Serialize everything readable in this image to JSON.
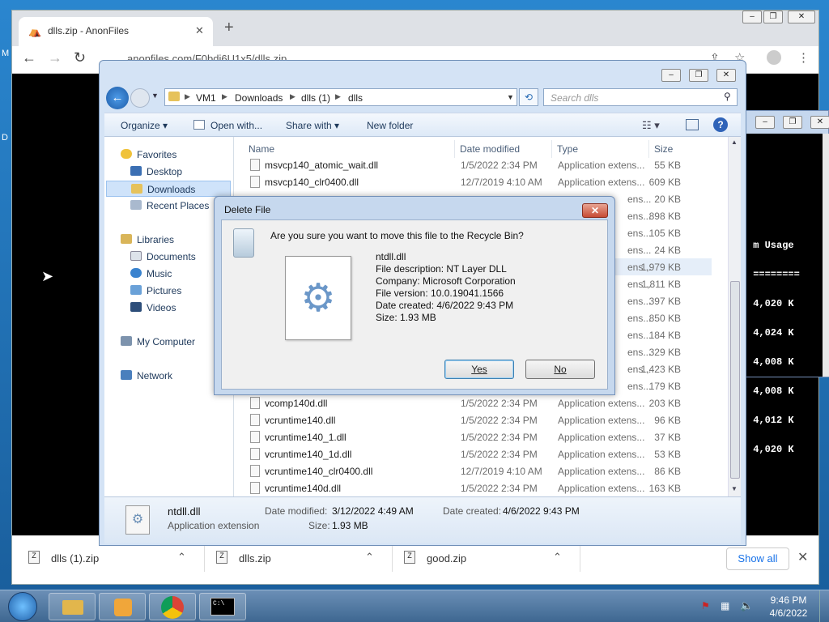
{
  "desktop": {
    "left_text_1": "M",
    "left_text_2": "D"
  },
  "chrome": {
    "tab_title": "dlls.zip - AnonFiles",
    "url": "anonfiles.com/F0bdi6U1x5/dlls.zip",
    "new_tab": "+",
    "tab_close": "✕",
    "downloads": [
      {
        "name": "dlls (1).zip"
      },
      {
        "name": "dlls.zip"
      },
      {
        "name": "good.zip"
      }
    ],
    "show_all": "Show all"
  },
  "console": {
    "lines": [
      " m Usage",
      " ========",
      " 4,020 K",
      " 4,024 K",
      " 4,008 K",
      " 4,008 K",
      " 4,012 K",
      " 4,020 K"
    ]
  },
  "explorer": {
    "breadcrumb": [
      "VM1",
      "Downloads",
      "dlls (1)",
      "dlls"
    ],
    "search_placeholder": "Search dlls",
    "commands": {
      "organize": "Organize",
      "open_with": "Open with...",
      "share_with": "Share with",
      "new_folder": "New folder"
    },
    "nav": {
      "favorites": "Favorites",
      "desktop": "Desktop",
      "downloads": "Downloads",
      "recent": "Recent Places",
      "libraries": "Libraries",
      "documents": "Documents",
      "music": "Music",
      "pictures": "Pictures",
      "videos": "Videos",
      "computer": "My Computer",
      "network": "Network"
    },
    "columns": {
      "name": "Name",
      "date": "Date modified",
      "type": "Type",
      "size": "Size"
    },
    "rows_top": [
      {
        "name": "msvcp140_atomic_wait.dll",
        "date": "1/5/2022 2:34 PM",
        "type": "Application extens...",
        "size": "55 KB"
      },
      {
        "name": "msvcp140_clr0400.dll",
        "date": "12/7/2019 4:10 AM",
        "type": "Application extens...",
        "size": "609 KB"
      }
    ],
    "rows_hidden": [
      {
        "type": "ens...",
        "size": "20 KB"
      },
      {
        "type": "ens...",
        "size": "898 KB"
      },
      {
        "type": "ens...",
        "size": "105 KB"
      },
      {
        "type": "ens...",
        "size": "24 KB"
      },
      {
        "type": "ens...",
        "size": "1,979 KB"
      },
      {
        "type": "ens...",
        "size": "1,811 KB"
      },
      {
        "type": "ens...",
        "size": "397 KB"
      },
      {
        "type": "ens...",
        "size": "850 KB"
      },
      {
        "type": "ens...",
        "size": "184 KB"
      },
      {
        "type": "ens...",
        "size": "329 KB"
      },
      {
        "type": "ens...",
        "size": "1,423 KB"
      },
      {
        "type": "ens...",
        "size": "179 KB"
      }
    ],
    "rows_bottom": [
      {
        "name": "vcomp140d.dll",
        "date": "1/5/2022 2:34 PM",
        "type": "Application extens...",
        "size": "203 KB"
      },
      {
        "name": "vcruntime140.dll",
        "date": "1/5/2022 2:34 PM",
        "type": "Application extens...",
        "size": "96 KB"
      },
      {
        "name": "vcruntime140_1.dll",
        "date": "1/5/2022 2:34 PM",
        "type": "Application extens...",
        "size": "37 KB"
      },
      {
        "name": "vcruntime140_1d.dll",
        "date": "1/5/2022 2:34 PM",
        "type": "Application extens...",
        "size": "53 KB"
      },
      {
        "name": "vcruntime140_clr0400.dll",
        "date": "12/7/2019 4:10 AM",
        "type": "Application extens...",
        "size": "86 KB"
      },
      {
        "name": "vcruntime140d.dll",
        "date": "1/5/2022 2:34 PM",
        "type": "Application extens...",
        "size": "163 KB"
      }
    ],
    "status": {
      "name": "ntdll.dll",
      "kind": "Application extension",
      "modified_label": "Date modified:",
      "modified": "3/12/2022 4:49 AM",
      "created_label": "Date created:",
      "created": "4/6/2022 9:43 PM",
      "size_label": "Size:",
      "size": "1.93 MB"
    }
  },
  "dialog": {
    "title": "Delete File",
    "question": "Are you sure you want to move this file to the Recycle Bin?",
    "file_name": "ntdll.dll",
    "description": "File description: NT Layer DLL",
    "company": "Company: Microsoft Corporation",
    "version": "File version: 10.0.19041.1566",
    "created": "Date created: 4/6/2022 9:43 PM",
    "size": "Size: 1.93 MB",
    "yes": "Yes",
    "no": "No"
  },
  "taskbar": {
    "time": "9:46 PM",
    "date": "4/6/2022",
    "cmd_label": "C:\\"
  }
}
